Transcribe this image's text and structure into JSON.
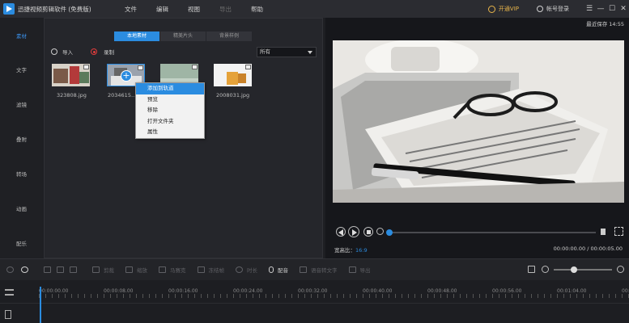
{
  "app": {
    "title": "迅捷视频剪辑软件 (免费版)",
    "menu": [
      "文件",
      "编辑",
      "视图",
      "导出",
      "帮助"
    ],
    "vip_label": "开通VIP",
    "login_label": "帐号登录",
    "window_controls": [
      "☰",
      "—",
      "☐",
      "✕"
    ]
  },
  "sidebar": {
    "items": [
      "素材",
      "文字",
      "滤镜",
      "叠附",
      "转场",
      "动画",
      "配乐"
    ]
  },
  "media": {
    "tabs": [
      "本地素材",
      "精美片头",
      "背景样例"
    ],
    "import_label": "导入",
    "record_label": "录制",
    "filter_value": "所有",
    "thumbnails": [
      {
        "name": "323808.jpg"
      },
      {
        "name": "2034615..."
      },
      {
        "name": ""
      },
      {
        "name": "2008031.jpg"
      }
    ],
    "context_menu": [
      "添加到轨道",
      "预览",
      "移除",
      "打开文件夹",
      "属性"
    ]
  },
  "preview": {
    "saved_label": "最近保存 14:55",
    "ratio_label": "宽高比：",
    "ratio_value": "16:9",
    "time_display": "00:00:00.00 / 00:00:05.00",
    "progress": 0
  },
  "toolbar": {
    "items": [
      "剪裁",
      "缩放",
      "马赛克",
      "冻结帧",
      "时长",
      "配音",
      "语音转文字",
      "导出"
    ],
    "enabled": [
      false,
      false,
      false,
      false,
      false,
      true,
      false,
      false
    ],
    "zoom_level": 0.35
  },
  "timeline": {
    "ticks": [
      "00:00:00.00",
      "00:00:08.00",
      "00:00:16.00",
      "00:00:24.00",
      "00:00:32.00",
      "00:00:40.00",
      "00:00:48.00",
      "00:00:56.00",
      "00:01:04.00",
      "00:01:12.00"
    ]
  },
  "colors": {
    "accent": "#2b8ce0",
    "vip": "#e8b54a",
    "record": "#e03c3c"
  }
}
